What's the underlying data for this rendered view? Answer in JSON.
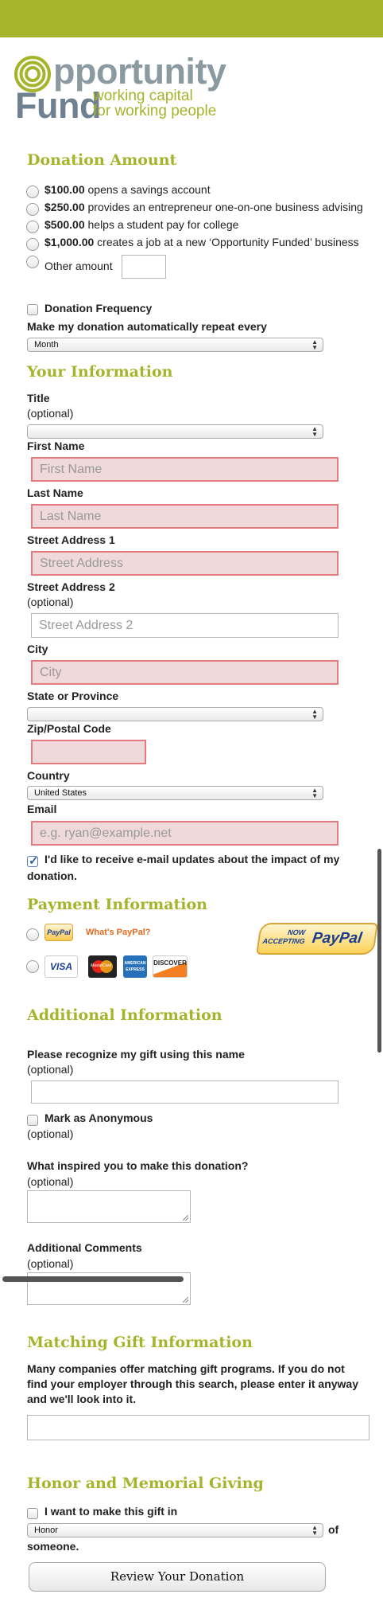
{
  "logo": {
    "word1": "pportunity",
    "word2": "Fund",
    "tagline1": "working capital",
    "tagline2": "for working people"
  },
  "donation": {
    "heading": "Donation Amount",
    "options": [
      {
        "amount": "$100.00",
        "text": " opens a savings account"
      },
      {
        "amount": "$250.00",
        "text": " provides an entrepreneur one-on-one business advising"
      },
      {
        "amount": "$500.00",
        "text": " helps a student pay for college"
      },
      {
        "amount": "$1,000.00",
        "text": " creates a job at a new ‘Opportunity Funded’ business"
      }
    ],
    "other_label": "Other amount",
    "frequency_label": "Donation Frequency",
    "repeat_label": "Make my donation automatically repeat every",
    "repeat_value": "Month"
  },
  "info": {
    "heading": "Your Information",
    "title_label": "Title",
    "optional": "(optional)",
    "title_value": "",
    "first_name_label": "First Name",
    "first_name_placeholder": "First Name",
    "last_name_label": "Last Name",
    "last_name_placeholder": "Last Name",
    "street1_label": "Street Address 1",
    "street1_placeholder": "Street Address",
    "street2_label": "Street Address 2",
    "street2_placeholder": "Street Address 2",
    "city_label": "City",
    "city_placeholder": "City",
    "state_label": "State or Province",
    "state_value": "",
    "zip_label": "Zip/Postal Code",
    "country_label": "Country",
    "country_value": "United States",
    "email_label": "Email",
    "email_placeholder": "e.g. ryan@example.net",
    "updates_line1": "I'd like to receive e-mail updates about the impact of my",
    "updates_line2": "donation."
  },
  "payment": {
    "heading": "Payment Information",
    "paypal_badge": "PayPal",
    "whats_paypal": "What's PayPal?",
    "now_accepting_1": "NOW",
    "now_accepting_2": "ACCEPTING",
    "now_accepting_brand": "PayPal",
    "cards": {
      "visa": "VISA",
      "mastercard": "MasterCard",
      "amex": "AMERICAN EXPRESS",
      "discover": "DISCOVER"
    }
  },
  "additional": {
    "heading": "Additional Information",
    "recognize_label": "Please recognize my gift using this name",
    "optional": "(optional)",
    "anonymous_label": "Mark as Anonymous",
    "inspired_label": "What inspired you to make this donation?",
    "comments_label": "Additional Comments"
  },
  "matching": {
    "heading": "Matching Gift Information",
    "desc1": "Many companies offer matching gift programs. If you do not",
    "desc2": "find your employer through this search, please enter it anyway",
    "desc3": "and we'll look into it."
  },
  "honor": {
    "heading": "Honor and Memorial Giving",
    "checkbox_label": "I want to make this gift in",
    "select_value": "Honor",
    "of_text": "of",
    "someone_text": "someone."
  },
  "review_button": "Review Your Donation",
  "colors": {
    "brand_green": "#a4b52c",
    "error_fill": "#f0d9da",
    "error_border": "#e57a7f"
  }
}
